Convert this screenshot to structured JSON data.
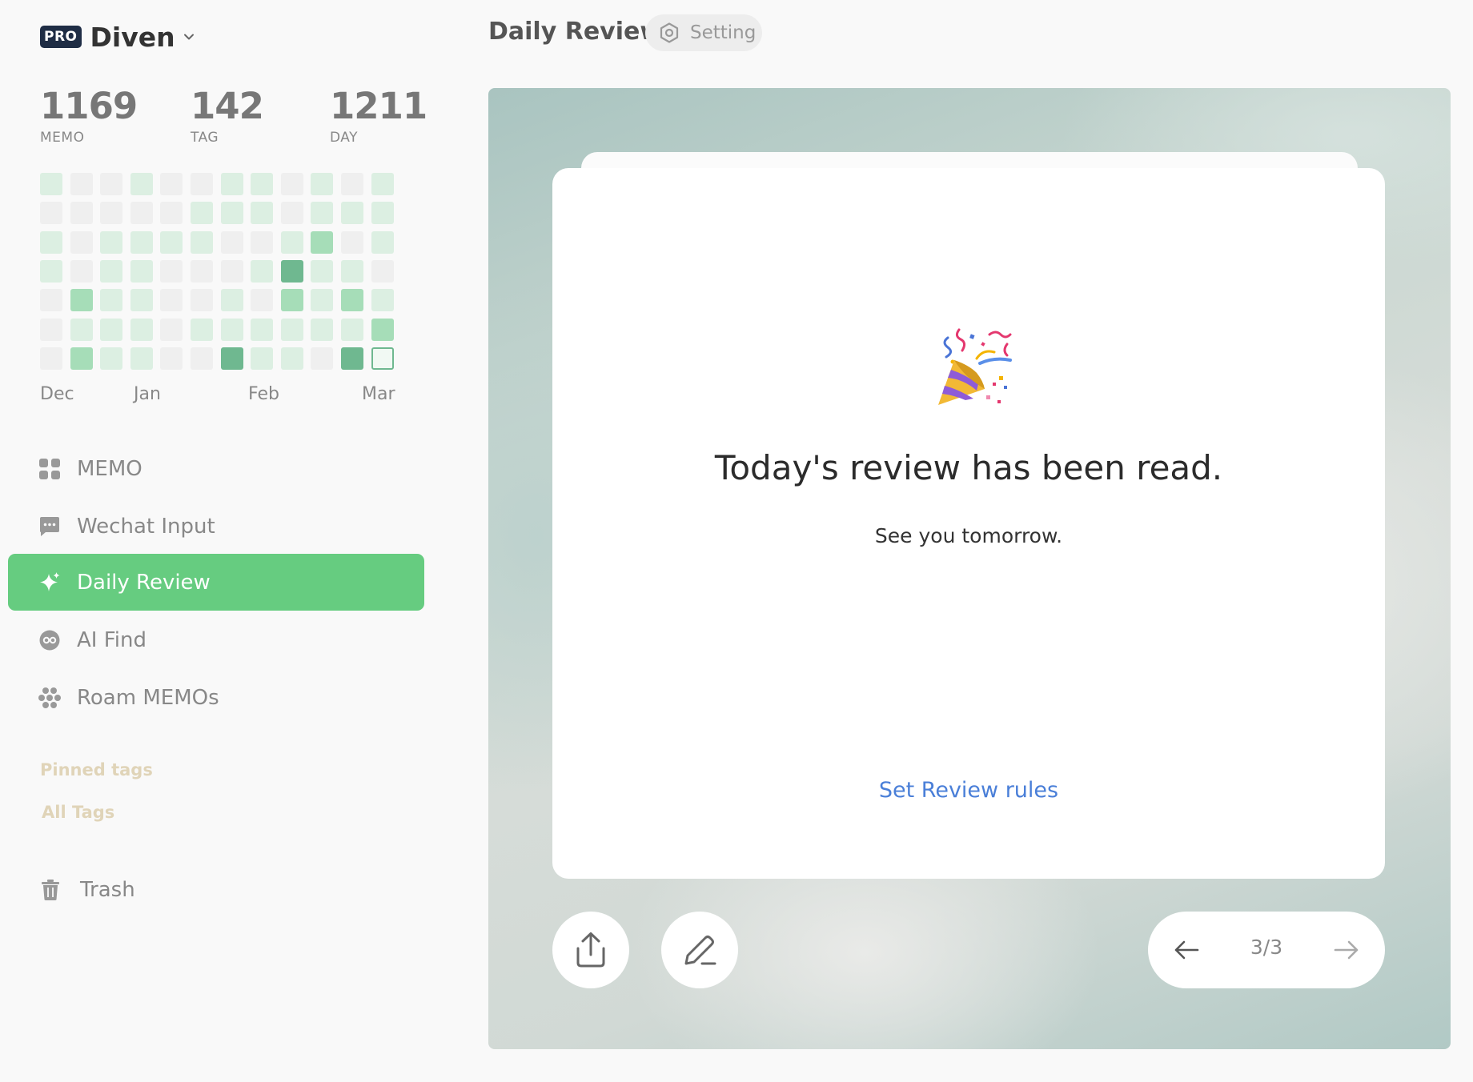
{
  "user": {
    "badge": "PRO",
    "name": "Diven"
  },
  "stats": [
    {
      "value": "1169",
      "label": "MEMO"
    },
    {
      "value": "142",
      "label": "TAG"
    },
    {
      "value": "1211",
      "label": "DAY"
    }
  ],
  "heatmap": {
    "levels": [
      [
        1,
        0,
        0,
        1,
        0,
        0,
        1,
        1,
        0,
        1,
        0,
        1
      ],
      [
        0,
        0,
        0,
        0,
        0,
        1,
        1,
        1,
        0,
        1,
        1,
        1
      ],
      [
        1,
        0,
        1,
        1,
        1,
        1,
        0,
        0,
        1,
        2,
        0,
        1
      ],
      [
        1,
        0,
        1,
        1,
        0,
        0,
        0,
        1,
        4,
        1,
        1,
        0
      ],
      [
        0,
        2,
        1,
        1,
        0,
        0,
        1,
        0,
        2,
        1,
        2,
        1
      ],
      [
        0,
        1,
        1,
        1,
        0,
        1,
        1,
        1,
        1,
        1,
        1,
        2
      ],
      [
        0,
        2,
        1,
        1,
        0,
        0,
        4,
        1,
        1,
        0,
        4,
        5
      ]
    ],
    "colors": [
      "#efefef",
      "#dcefe2",
      "#a6ddb8",
      "#8fcfa5",
      "#6fb890",
      "#ffffff"
    ]
  },
  "months": [
    "Dec",
    "Jan",
    "Feb",
    "Mar"
  ],
  "nav": [
    {
      "label": "MEMO",
      "icon": "grid-icon",
      "active": false
    },
    {
      "label": "Wechat Input",
      "icon": "chat-icon",
      "active": false
    },
    {
      "label": "Daily Review",
      "icon": "sparkle-icon",
      "active": true
    },
    {
      "label": "AI Find",
      "icon": "glasses-icon",
      "active": false
    },
    {
      "label": "Roam MEMOs",
      "icon": "cluster-icon",
      "active": false
    }
  ],
  "sections": {
    "pinned_tags": "Pinned tags",
    "all_tags": "All Tags"
  },
  "trash": {
    "label": "Trash",
    "icon": "trash-icon"
  },
  "header": {
    "title": "Daily Review",
    "setting_label": "Setting"
  },
  "review": {
    "emoji": "party-popper",
    "title": "Today's review has been read.",
    "subtitle": "See you tomorrow.",
    "link": "Set Review rules",
    "page": "3/3"
  },
  "colors": {
    "accent": "#66cc80",
    "link": "#4a7fd8",
    "pro_badge": "#1f2d45",
    "section_label": "#e0d4b8"
  }
}
